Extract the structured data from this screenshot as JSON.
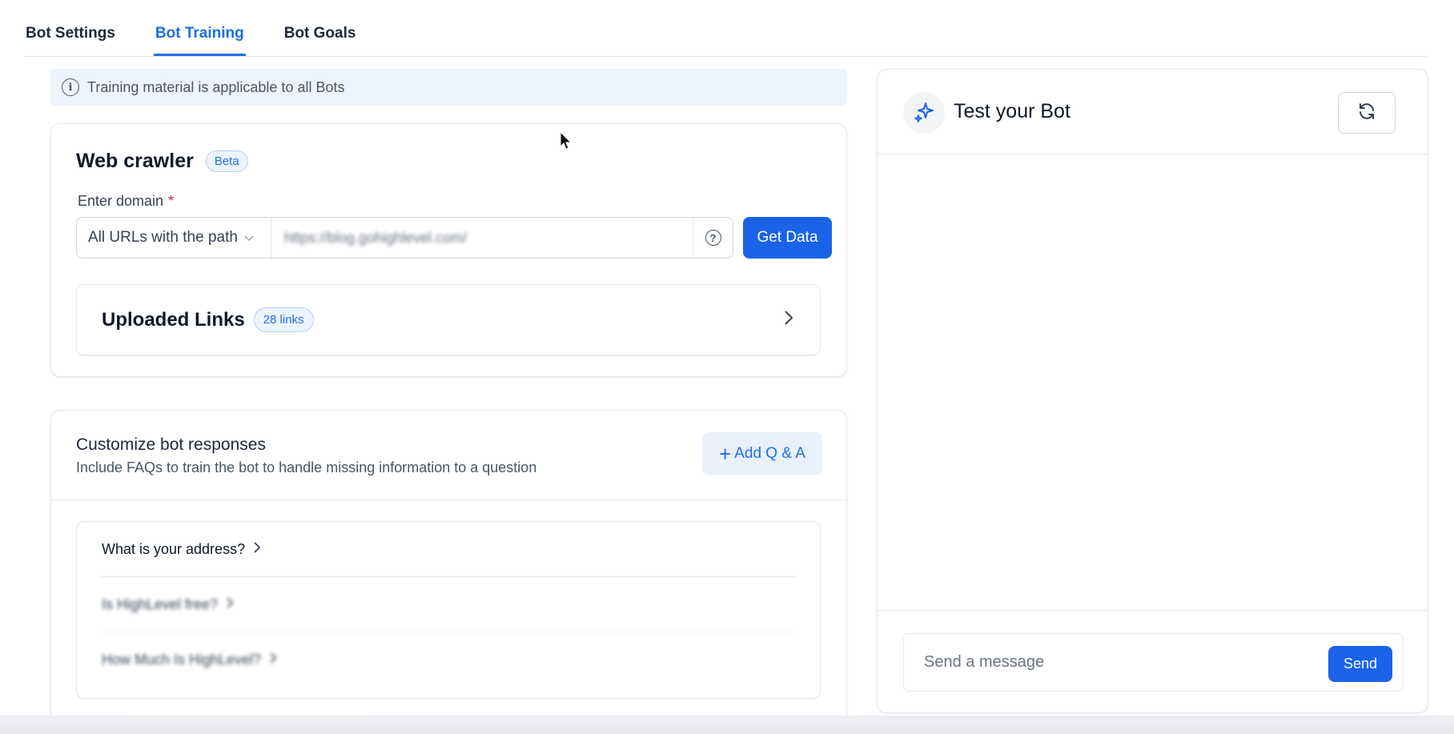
{
  "tabs": [
    {
      "label": "Bot Settings",
      "active": false
    },
    {
      "label": "Bot Training",
      "active": true
    },
    {
      "label": "Bot Goals",
      "active": false
    }
  ],
  "info_banner": {
    "icon": "info-icon",
    "text": "Training material is applicable to all Bots"
  },
  "web_crawler": {
    "title": "Web crawler",
    "badge": "Beta",
    "domain_label": "Enter domain",
    "required_mark": "*",
    "match_select": "All URLs with the path",
    "url_value": "https://blog.gohighlevel.com/",
    "get_data_label": "Get Data",
    "uploaded_links": {
      "title": "Uploaded Links",
      "badge": "28 links"
    }
  },
  "customize": {
    "title": "Customize bot responses",
    "subtitle": "Include FAQs to train the bot to handle missing information to a question",
    "add_label": "Add Q & A",
    "questions": [
      {
        "text": "What is your address?",
        "blurred": false
      },
      {
        "text": "Is HighLevel free?",
        "blurred": true
      },
      {
        "text": "How Much Is HighLevel?",
        "blurred": true
      }
    ]
  },
  "test_bot": {
    "title": "Test your Bot",
    "message_placeholder": "Send a message",
    "send_label": "Send"
  },
  "colors": {
    "accent": "#1a63e8",
    "accent_text": "#1d6ee6",
    "banner_bg": "#eef4fd"
  }
}
